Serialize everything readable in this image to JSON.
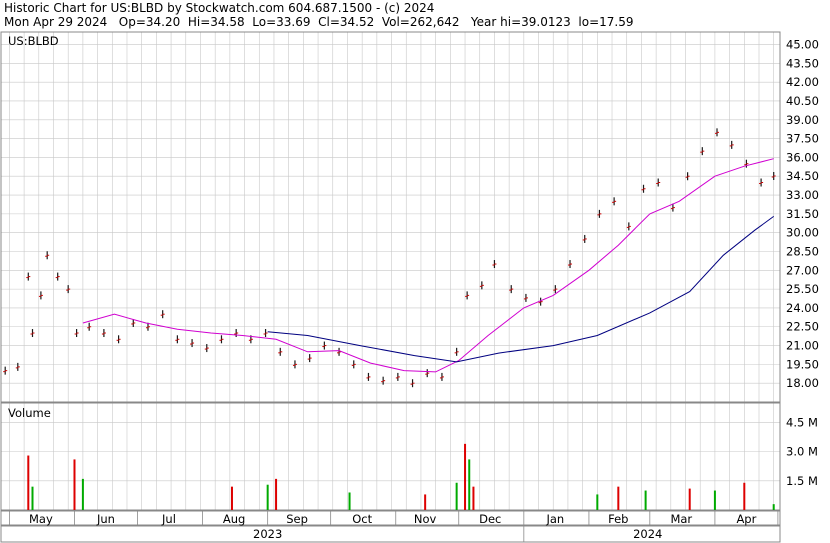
{
  "header": {
    "line1": "Historic Chart for US:BLBD by Stockwatch.com 604.687.1500 - (c) 2024",
    "line2": "Mon Apr 29 2024   Op=34.20  Hi=34.58  Lo=33.69  Cl=34.52  Vol=262,642   Year hi=39.0123  lo=17.59"
  },
  "colors": {
    "price_bar": "#1a1a1a",
    "price_tick": "#cc0000",
    "ma_short": "#d000d0",
    "ma_long": "#000080",
    "volume_up": "#00aa00",
    "volume_down": "#dd0000",
    "grid": "#c8c8c8"
  },
  "chart_data": [
    {
      "type": "line",
      "title": "US:BLBD",
      "ylim": [
        16.5,
        46.0
      ],
      "y_ticks": [
        "45.00",
        "43.50",
        "42.00",
        "40.50",
        "39.00",
        "37.50",
        "36.00",
        "34.50",
        "33.00",
        "31.50",
        "30.00",
        "28.50",
        "27.00",
        "25.50",
        "24.00",
        "22.50",
        "21.00",
        "19.50",
        "18.00"
      ],
      "x_ticks": [
        "May",
        "Jun",
        "Jul",
        "Aug",
        "Sep",
        "Oct",
        "Nov",
        "Dec",
        "Jan",
        "Feb",
        "Mar",
        "Apr"
      ],
      "year_labels": [
        "2023",
        "2024"
      ],
      "series": [
        {
          "values": [
            {
              "x": "2023-04-29",
              "y": 19.0
            },
            {
              "x": "2023-05-05",
              "y": 19.3
            },
            {
              "x": "2023-05-10",
              "y": 26.5
            },
            {
              "x": "2023-05-12",
              "y": 22.0
            },
            {
              "x": "2023-05-16",
              "y": 25.0
            },
            {
              "x": "2023-05-19",
              "y": 28.2
            },
            {
              "x": "2023-05-24",
              "y": 26.5
            },
            {
              "x": "2023-05-29",
              "y": 25.5
            },
            {
              "x": "2023-06-02",
              "y": 22.0
            },
            {
              "x": "2023-06-08",
              "y": 22.5
            },
            {
              "x": "2023-06-15",
              "y": 22.0
            },
            {
              "x": "2023-06-22",
              "y": 21.5
            },
            {
              "x": "2023-06-29",
              "y": 22.8
            },
            {
              "x": "2023-07-06",
              "y": 22.5
            },
            {
              "x": "2023-07-13",
              "y": 23.5
            },
            {
              "x": "2023-07-20",
              "y": 21.5
            },
            {
              "x": "2023-07-27",
              "y": 21.2
            },
            {
              "x": "2023-08-03",
              "y": 20.8
            },
            {
              "x": "2023-08-10",
              "y": 21.5
            },
            {
              "x": "2023-08-17",
              "y": 22.0
            },
            {
              "x": "2023-08-24",
              "y": 21.5
            },
            {
              "x": "2023-08-31",
              "y": 22.0
            },
            {
              "x": "2023-09-07",
              "y": 20.5
            },
            {
              "x": "2023-09-14",
              "y": 19.5
            },
            {
              "x": "2023-09-21",
              "y": 20.0
            },
            {
              "x": "2023-09-28",
              "y": 21.0
            },
            {
              "x": "2023-10-05",
              "y": 20.5
            },
            {
              "x": "2023-10-12",
              "y": 19.5
            },
            {
              "x": "2023-10-19",
              "y": 18.5
            },
            {
              "x": "2023-10-26",
              "y": 18.2
            },
            {
              "x": "2023-11-02",
              "y": 18.5
            },
            {
              "x": "2023-11-09",
              "y": 18.0
            },
            {
              "x": "2023-11-16",
              "y": 18.8
            },
            {
              "x": "2023-11-23",
              "y": 18.5
            },
            {
              "x": "2023-11-30",
              "y": 20.5
            },
            {
              "x": "2023-12-05",
              "y": 25.0
            },
            {
              "x": "2023-12-12",
              "y": 25.8
            },
            {
              "x": "2023-12-18",
              "y": 27.5
            },
            {
              "x": "2023-12-26",
              "y": 25.5
            },
            {
              "x": "2024-01-02",
              "y": 24.8
            },
            {
              "x": "2024-01-09",
              "y": 24.5
            },
            {
              "x": "2024-01-16",
              "y": 25.5
            },
            {
              "x": "2024-01-23",
              "y": 27.5
            },
            {
              "x": "2024-01-30",
              "y": 29.5
            },
            {
              "x": "2024-02-06",
              "y": 31.5
            },
            {
              "x": "2024-02-13",
              "y": 32.5
            },
            {
              "x": "2024-02-20",
              "y": 30.5
            },
            {
              "x": "2024-02-27",
              "y": 33.5
            },
            {
              "x": "2024-03-05",
              "y": 34.0
            },
            {
              "x": "2024-03-12",
              "y": 32.0
            },
            {
              "x": "2024-03-19",
              "y": 34.5
            },
            {
              "x": "2024-03-26",
              "y": 36.5
            },
            {
              "x": "2024-04-02",
              "y": 38.0
            },
            {
              "x": "2024-04-09",
              "y": 37.0
            },
            {
              "x": "2024-04-16",
              "y": 35.5
            },
            {
              "x": "2024-04-23",
              "y": 34.0
            },
            {
              "x": "2024-04-29",
              "y": 34.52
            }
          ]
        },
        {
          "values": [
            {
              "x": "2023-06-05",
              "y": 22.8
            },
            {
              "x": "2023-06-20",
              "y": 23.5
            },
            {
              "x": "2023-07-05",
              "y": 22.8
            },
            {
              "x": "2023-07-20",
              "y": 22.3
            },
            {
              "x": "2023-08-05",
              "y": 22.0
            },
            {
              "x": "2023-08-20",
              "y": 21.8
            },
            {
              "x": "2023-09-05",
              "y": 21.5
            },
            {
              "x": "2023-09-20",
              "y": 20.5
            },
            {
              "x": "2023-10-05",
              "y": 20.6
            },
            {
              "x": "2023-10-20",
              "y": 19.6
            },
            {
              "x": "2023-11-05",
              "y": 19.0
            },
            {
              "x": "2023-11-20",
              "y": 18.9
            },
            {
              "x": "2023-12-01",
              "y": 19.8
            },
            {
              "x": "2023-12-15",
              "y": 21.8
            },
            {
              "x": "2024-01-01",
              "y": 24.0
            },
            {
              "x": "2024-01-15",
              "y": 25.0
            },
            {
              "x": "2024-02-01",
              "y": 27.0
            },
            {
              "x": "2024-02-15",
              "y": 29.0
            },
            {
              "x": "2024-03-01",
              "y": 31.5
            },
            {
              "x": "2024-03-15",
              "y": 32.5
            },
            {
              "x": "2024-04-01",
              "y": 34.5
            },
            {
              "x": "2024-04-15",
              "y": 35.3
            },
            {
              "x": "2024-04-29",
              "y": 35.9
            }
          ]
        },
        {
          "values": [
            {
              "x": "2023-09-01",
              "y": 22.1
            },
            {
              "x": "2023-09-20",
              "y": 21.8
            },
            {
              "x": "2023-10-15",
              "y": 21.0
            },
            {
              "x": "2023-11-10",
              "y": 20.2
            },
            {
              "x": "2023-11-30",
              "y": 19.7
            },
            {
              "x": "2023-12-20",
              "y": 20.4
            },
            {
              "x": "2024-01-15",
              "y": 21.0
            },
            {
              "x": "2024-02-05",
              "y": 21.8
            },
            {
              "x": "2024-03-01",
              "y": 23.6
            },
            {
              "x": "2024-03-20",
              "y": 25.3
            },
            {
              "x": "2024-04-05",
              "y": 28.2
            },
            {
              "x": "2024-04-20",
              "y": 30.2
            },
            {
              "x": "2024-04-29",
              "y": 31.3
            }
          ]
        }
      ]
    },
    {
      "type": "bar",
      "title": "Volume",
      "ylim": [
        0,
        5.5
      ],
      "y_ticks": [
        "4.5 M",
        "3.0 M",
        "1.5 M"
      ],
      "x_ticks": [
        "May",
        "Jun",
        "Jul",
        "Aug",
        "Sep",
        "Oct",
        "Nov",
        "Dec",
        "Jan",
        "Feb",
        "Mar",
        "Apr"
      ],
      "series": [
        {
          "values": [
            {
              "x": "2023-05-10",
              "y": 2.8
            },
            {
              "x": "2023-05-12",
              "y": 1.2
            },
            {
              "x": "2023-06-01",
              "y": 2.6
            },
            {
              "x": "2023-06-05",
              "y": 1.6
            },
            {
              "x": "2023-08-15",
              "y": 1.2
            },
            {
              "x": "2023-09-01",
              "y": 1.3
            },
            {
              "x": "2023-09-05",
              "y": 1.6
            },
            {
              "x": "2023-10-10",
              "y": 0.9
            },
            {
              "x": "2023-11-15",
              "y": 0.8
            },
            {
              "x": "2023-11-30",
              "y": 1.4
            },
            {
              "x": "2023-12-04",
              "y": 3.4
            },
            {
              "x": "2023-12-06",
              "y": 2.6
            },
            {
              "x": "2023-12-08",
              "y": 1.2
            },
            {
              "x": "2024-02-05",
              "y": 0.8
            },
            {
              "x": "2024-02-15",
              "y": 1.2
            },
            {
              "x": "2024-02-28",
              "y": 1.0
            },
            {
              "x": "2024-03-20",
              "y": 1.1
            },
            {
              "x": "2024-04-01",
              "y": 1.0
            },
            {
              "x": "2024-04-15",
              "y": 1.4
            },
            {
              "x": "2024-04-29",
              "y": 0.3
            }
          ]
        }
      ]
    }
  ]
}
